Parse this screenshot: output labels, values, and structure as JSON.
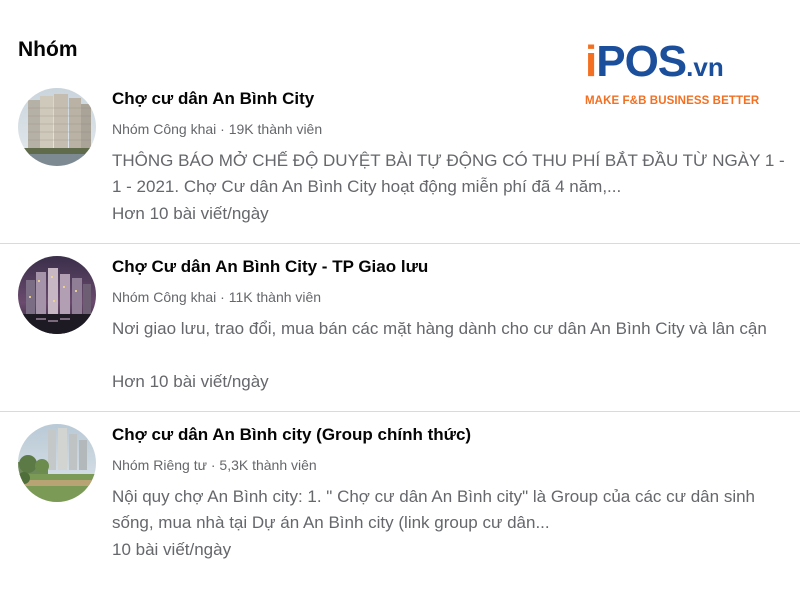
{
  "section": {
    "title": "Nhóm"
  },
  "brand": {
    "logo_i": "i",
    "logo_main": "POS",
    "logo_suffix": ".vn",
    "tagline": "MAKE F&B BUSINESS BETTER",
    "colors": {
      "blue": "#1b4f9c",
      "orange": "#f36f21"
    }
  },
  "groups": [
    {
      "name": "Chợ cư dân An Bình City",
      "meta": "Nhóm Công khai · 19K thành viên",
      "description": "THÔNG BÁO MỞ CHẾ ĐỘ DUYỆT BÀI TỰ ĐỘNG CÓ THU PHÍ BẮT ĐẦU TỪ NGÀY 1 - 1 - 2021. Chợ Cư dân An Bình City hoạt động miễn phí đã 4 năm,...",
      "activity": "Hơn 10 bài viết/ngày",
      "avatar": "daytime-towers-photo"
    },
    {
      "name": "Chợ Cư dân An Bình City - TP Giao lưu",
      "meta": "Nhóm Công khai · 11K thành viên",
      "description": "Nơi giao lưu, trao đổi, mua bán các mặt hàng dành cho cư dân An Bình City và lân cận",
      "activity": "Hơn 10 bài viết/ngày",
      "avatar": "night-towers-photo"
    },
    {
      "name": "Chợ cư dân An Bình city (Group chính thức)",
      "meta": "Nhóm Riêng tư · 5,3K thành viên",
      "description": "Nội quy chợ An Bình city: 1. \" Chợ cư dân An Bình city\" là Group của các cư dân sinh sống, mua nhà tại Dự án An Bình city (link group cư dân...",
      "activity": "10 bài viết/ngày",
      "avatar": "park-towers-photo"
    }
  ],
  "colors": {
    "text_primary": "#050505",
    "text_secondary": "#65676b",
    "divider": "#d9dadc"
  }
}
